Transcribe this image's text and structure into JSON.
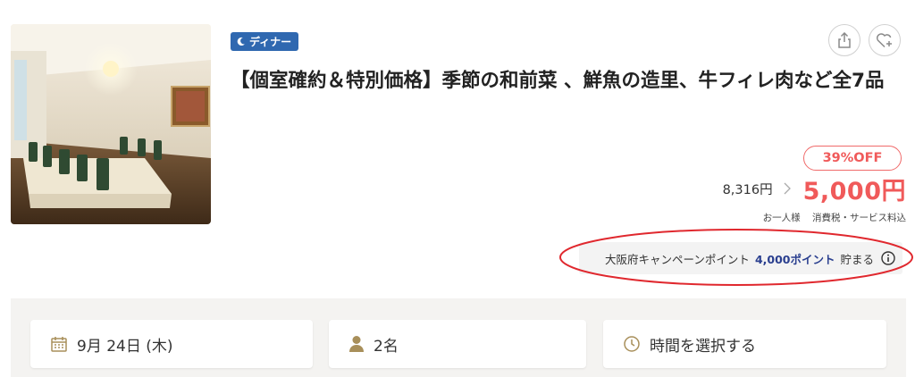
{
  "badge": {
    "label": "ディナー",
    "icon": "moon-icon",
    "color": "#2f68b0"
  },
  "title": "【個室確約＆特別価格】季節の和前菜 、鮮魚の造里、牛フィレ肉など全7品",
  "actions": {
    "share_icon": "share-icon",
    "favorite_icon": "heart-plus-icon"
  },
  "pricing": {
    "discount_label": "39%OFF",
    "original_price": "8,316円",
    "sale_price": "5,000円",
    "per_person": "お一人様",
    "tax_note": "消費税・サービス料込",
    "accent_color": "#f05a5a"
  },
  "campaign": {
    "prefix": "大阪府キャンペーンポイント",
    "points": "4,000ポイント",
    "suffix": "貯まる",
    "info_icon": "info-icon"
  },
  "booking": {
    "date": "9月 24日 (木)",
    "date_icon": "calendar-icon",
    "people": "2名",
    "people_icon": "person-icon",
    "time_placeholder": "時間を選択する",
    "time_icon": "clock-icon",
    "icon_color": "#a88f5a"
  }
}
